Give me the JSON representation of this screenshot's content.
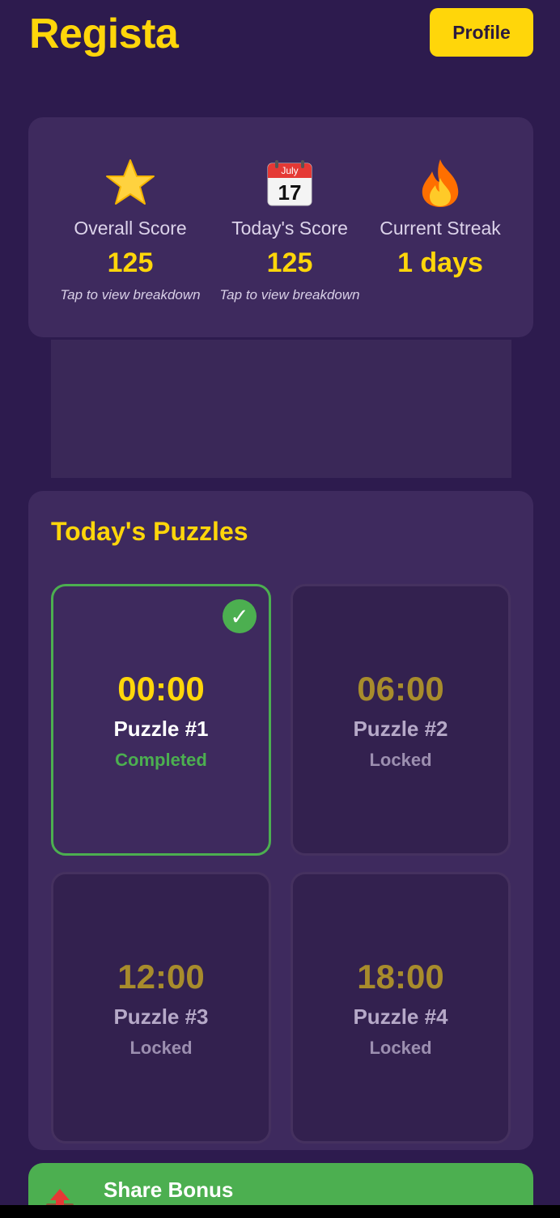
{
  "app": {
    "title": "Regista"
  },
  "header": {
    "profile_label": "Profile"
  },
  "stats": [
    {
      "icon": "star-icon",
      "label": "Overall Score",
      "value": "125",
      "hint": "Tap to view breakdown"
    },
    {
      "icon": "calendar-icon",
      "icon_month": "July",
      "icon_day": "17",
      "label": "Today's Score",
      "value": "125",
      "hint": "Tap to view breakdown"
    },
    {
      "icon": "fire-icon",
      "label": "Current Streak",
      "value": "1 days",
      "hint": ""
    }
  ],
  "puzzles": {
    "title": "Today's Puzzles",
    "items": [
      {
        "time": "00:00",
        "name": "Puzzle #1",
        "status": "Completed",
        "completed": true
      },
      {
        "time": "06:00",
        "name": "Puzzle #2",
        "status": "Locked",
        "completed": false
      },
      {
        "time": "12:00",
        "name": "Puzzle #3",
        "status": "Locked",
        "completed": false
      },
      {
        "time": "18:00",
        "name": "Puzzle #4",
        "status": "Locked",
        "completed": false
      }
    ]
  },
  "share": {
    "title": "Share Bonus",
    "icon": "share-upload-icon"
  },
  "colors": {
    "background": "#2d1b4e",
    "card": "#3e2a5e",
    "accent": "#ffd60a",
    "success": "#4caf50"
  }
}
